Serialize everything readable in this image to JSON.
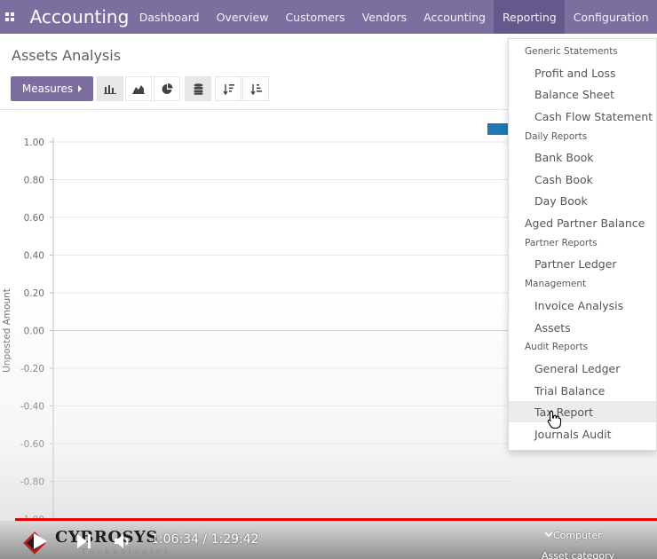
{
  "navbar": {
    "app_title": "Accounting",
    "menu": [
      {
        "label": "Dashboard"
      },
      {
        "label": "Overview"
      },
      {
        "label": "Customers"
      },
      {
        "label": "Vendors"
      },
      {
        "label": "Accounting"
      },
      {
        "label": "Reporting",
        "active": true
      },
      {
        "label": "Configuration"
      }
    ]
  },
  "control_panel": {
    "title": "Assets Analysis",
    "measures_label": "Measures"
  },
  "chart_data": {
    "type": "bar",
    "title": "",
    "xlabel": "",
    "ylabel": "Unposted Amount",
    "y_ticks": [
      "1.00",
      "0.80",
      "0.60",
      "0.40",
      "0.20",
      "0.00",
      "-0.20",
      "-0.40",
      "-0.60",
      "-0.80",
      "-1.00"
    ],
    "ylim": [
      -1,
      1
    ],
    "grid": true,
    "legend": "top-right",
    "series_color": "#1f77b4",
    "categories": [],
    "values": []
  },
  "reporting_dropdown": {
    "sections": [
      {
        "header": "Generic Statements",
        "items": [
          "Profit and Loss",
          "Balance Sheet",
          "Cash Flow Statement"
        ]
      },
      {
        "header": "Daily Reports",
        "items": [
          "Bank Book",
          "Cash Book",
          "Day Book"
        ]
      },
      {
        "top_item": "Aged Partner Balance"
      },
      {
        "header": "Partner Reports",
        "items": [
          "Partner Ledger"
        ]
      },
      {
        "header": "Management",
        "items": [
          "Invoice Analysis",
          "Assets"
        ]
      },
      {
        "header": "Audit Reports",
        "items": [
          "General Ledger",
          "Trial Balance",
          "Tax Report",
          "Journals Audit"
        ]
      }
    ],
    "hovered_item": "Tax Report"
  },
  "video_player": {
    "time_display": "1:06:34 / 1:29:42",
    "brand_name": "CYBROSYS",
    "brand_sub": "Technologies",
    "progress_color": "#e60000",
    "tooltip_line1": "Computer",
    "tooltip_line2": "Asset category"
  }
}
